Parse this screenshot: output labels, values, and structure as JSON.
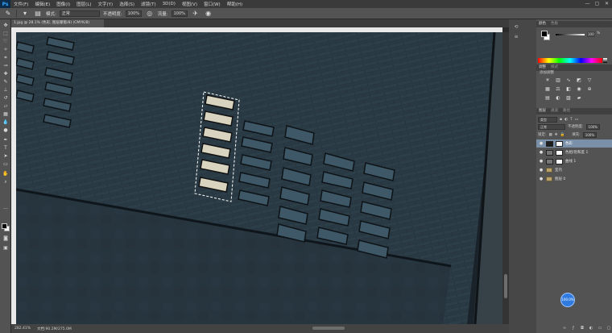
{
  "app": {
    "logo": "Ps"
  },
  "menu": [
    "文件(F)",
    "编辑(E)",
    "图像(I)",
    "图层(L)",
    "文字(Y)",
    "选择(S)",
    "滤镜(T)",
    "3D(D)",
    "视图(V)",
    "窗口(W)",
    "帮助(H)"
  ],
  "window_controls": [
    "—",
    "▢",
    "✕"
  ],
  "options": {
    "mode_label": "模式:",
    "mode_value": "正常",
    "opacity_label": "不透明度:",
    "opacity_value": "100%",
    "flow_label": "流量:",
    "flow_value": "100%"
  },
  "document_tab": "1.jpg @ 28.1% (色彩, 图层蒙版/8) (CMYK/8)",
  "status": {
    "zoom": "282.41%",
    "doc": "文档:90.2M/275.0M"
  },
  "panels": {
    "color_tabs": [
      "颜色",
      "色板"
    ],
    "color_value": "100",
    "color_pct": "%",
    "adjust_tabs": [
      "调整",
      "样式"
    ],
    "adjust_label": "添加调整",
    "layers_tabs": [
      "图层",
      "通道",
      "路径"
    ],
    "kind_label": "类型",
    "blend_mode": "正常",
    "opacity_label": "不透明度:",
    "opacity_value": "100%",
    "lock_label": "锁定:",
    "fill_label": "填充:",
    "fill_value": "100%",
    "layers": [
      {
        "name": "色彩",
        "selected": true
      },
      {
        "name": "色相/饱和度 1",
        "selected": false
      },
      {
        "name": "曲线 1",
        "selected": false
      },
      {
        "name": "室内",
        "selected": false
      },
      {
        "name": "图层 0",
        "selected": false
      }
    ]
  },
  "nav_badge": "100.0%",
  "colors": {
    "accent": "#2f7be0",
    "selected_layer": "#7a8fa8",
    "wall": "#2a3a44"
  },
  "icons": {
    "brush_tool": "brush-icon",
    "eye": "eye-icon"
  }
}
